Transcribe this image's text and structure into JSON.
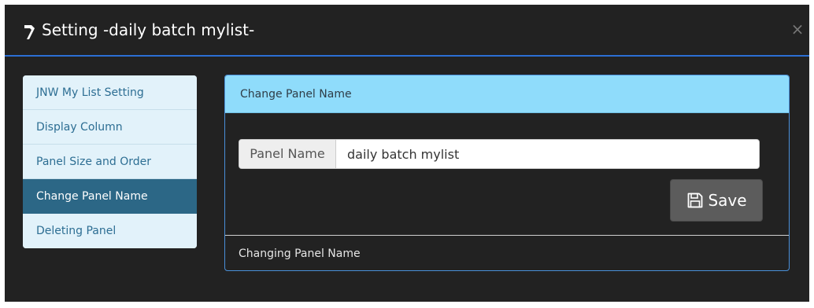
{
  "dialog": {
    "title": "Setting -daily batch mylist-",
    "header_icon": "wrench-icon",
    "close_symbol": "×",
    "accent_color": "#2c6fd4"
  },
  "nav": {
    "items": [
      {
        "label": "JNW My List Setting",
        "active": false
      },
      {
        "label": "Display Column",
        "active": false
      },
      {
        "label": "Panel Size and Order",
        "active": false
      },
      {
        "label": "Change Panel Name",
        "active": true
      },
      {
        "label": "Deleting Panel",
        "active": false
      }
    ]
  },
  "panel": {
    "heading": "Change Panel Name",
    "heading_color": "#8fdcfb",
    "field_label": "Panel Name",
    "field_value": "daily batch mylist",
    "save_label": "Save",
    "save_icon": "floppy-disk-icon",
    "footer": "Changing Panel Name"
  }
}
